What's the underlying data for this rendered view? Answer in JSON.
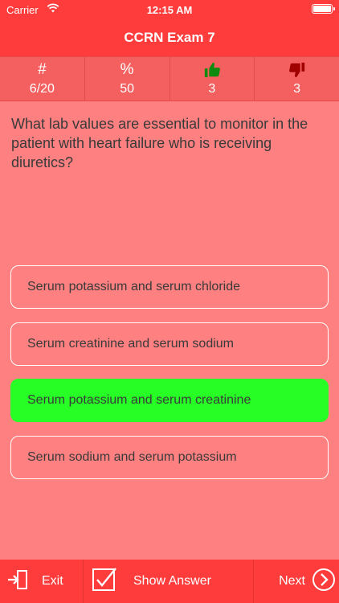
{
  "status": {
    "carrier": "Carrier",
    "time": "12:15 AM"
  },
  "nav": {
    "title": "CCRN Exam 7"
  },
  "stats": [
    {
      "icon": "hash-icon",
      "head": "#",
      "value": "6/20"
    },
    {
      "icon": "percent-icon",
      "head": "%",
      "value": "50"
    },
    {
      "icon": "thumbs-up-icon",
      "head": "",
      "value": "3"
    },
    {
      "icon": "thumbs-down-icon",
      "head": "",
      "value": "3"
    }
  ],
  "question": "What lab values are essential to monitor in the patient with heart failure who is receiving diuretics?",
  "answers": [
    {
      "label": "Serum potassium and serum chloride",
      "correct": false
    },
    {
      "label": "Serum creatinine and serum sodium",
      "correct": false
    },
    {
      "label": "Serum potassium and serum creatinine",
      "correct": true
    },
    {
      "label": "Serum sodium and serum potassium",
      "correct": false
    }
  ],
  "toolbar": {
    "exit_label": "Exit",
    "show_answer_label": "Show Answer",
    "next_label": "Next"
  },
  "colors": {
    "header": "#fe3c3c",
    "background": "#ff8080",
    "correct": "#26fe26",
    "thumbs_up": "#0e8a0e",
    "thumbs_down": "#a00000"
  }
}
